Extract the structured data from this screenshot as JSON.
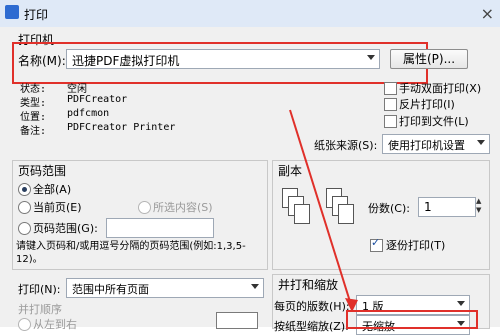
{
  "window": {
    "title": "打印",
    "close_glyph": "×"
  },
  "printer": {
    "group_label": "打印机",
    "name_label": "名称(M):",
    "name_value": "迅捷PDF虚拟打印机",
    "properties_button": "属性(P)...",
    "status_label": "状态:",
    "status_value": "空闲",
    "type_label": "类型:",
    "type_value": "PDFCreator",
    "location_label": "位置:",
    "location_value": "pdfcmon",
    "comment_label": "备注:",
    "comment_value": "PDFCreator Printer",
    "manual_duplex": "手动双面打印(X)",
    "reverse_print": "反片打印(I)",
    "print_to_file": "打印到文件(L)",
    "paper_source_label": "纸张来源(S):",
    "paper_source_value": "使用打印机设置"
  },
  "page_range": {
    "group_label": "页码范围",
    "all": "全部(A)",
    "current": "当前页(E)",
    "selection": "所选内容(S)",
    "range": "页码范围(G):",
    "range_value": "",
    "hint": "请键入页码和/或用逗号分隔的页码范围(例如:1,3,5-12)。"
  },
  "copies": {
    "group_label": "副本",
    "copies_label": "份数(C):",
    "copies_value": "1",
    "collate": "逐份打印(T)"
  },
  "print_what": {
    "label": "打印(N):",
    "value": "范围中所有页面",
    "order_label": "并打顺序",
    "order_value": "从左到右"
  },
  "zoom": {
    "group_label": "并打和缩放",
    "pages_per_sheet_label": "每页的版数(H):",
    "pages_per_sheet_value": "1 版",
    "scale_label": "按纸型缩放(Z):",
    "scale_value": "无缩放"
  },
  "colors": {
    "annotation": "#e0302a"
  }
}
